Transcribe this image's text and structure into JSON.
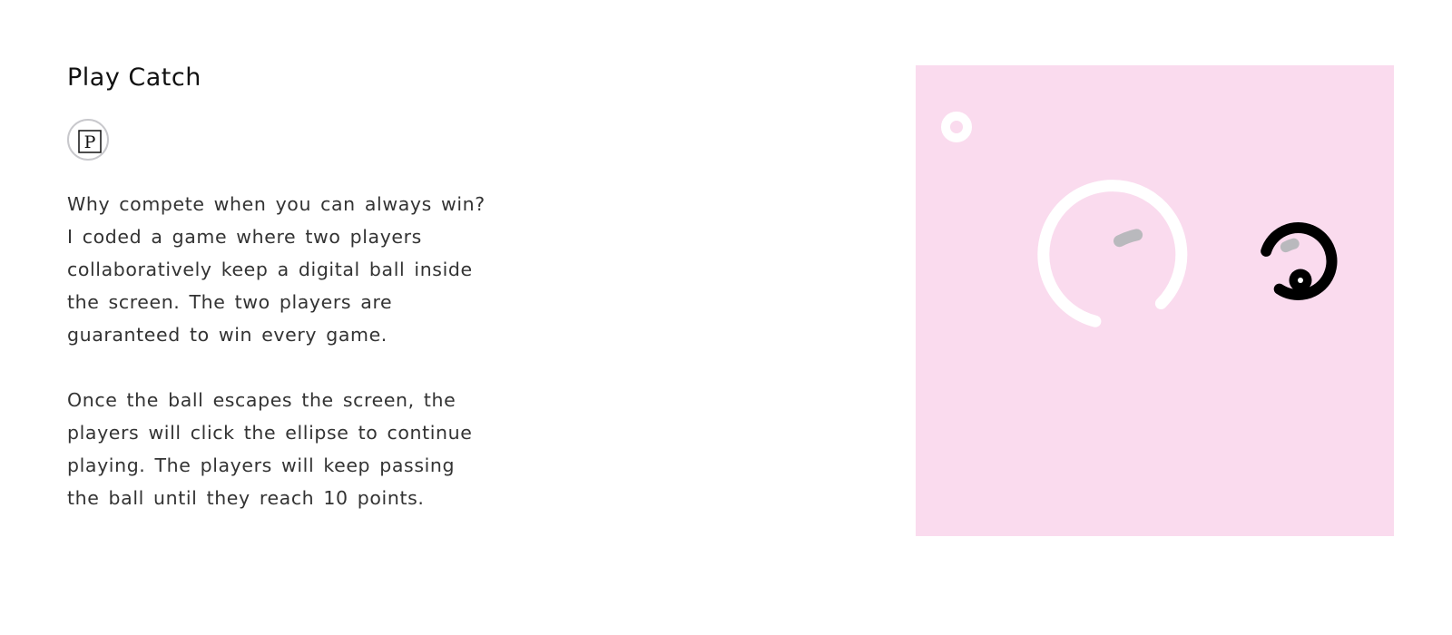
{
  "page": {
    "title": "Play Catch"
  },
  "author": {
    "icon": "p-logo-icon",
    "glyph": "P"
  },
  "description": {
    "paragraphs": [
      "Why compete when you can always win? I coded a game where two players collaboratively keep a digital ball inside the screen. The two players are guaranteed to win every game.",
      "Once the ball escapes the screen, the players will click the ellipse to continue playing. The players will keep passing the ball until they reach 10 points."
    ]
  },
  "game": {
    "background_color": "#fadbee",
    "ball_color": "#ffffff",
    "player_one_ring_color": "#ffffff",
    "player_two_ring_color": "#000000",
    "marker_color": "#b9b9bd"
  }
}
